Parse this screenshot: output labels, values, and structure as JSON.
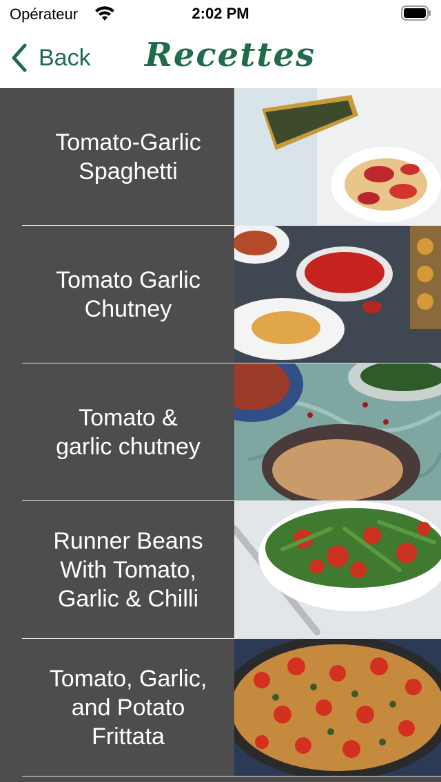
{
  "status_bar": {
    "carrier": "Opérateur",
    "time": "2:02 PM",
    "wifi_icon": "wifi-icon",
    "battery_icon": "battery-icon"
  },
  "nav": {
    "back_label": "Back",
    "back_icon": "chevron-left-icon",
    "title": "Recettes",
    "tint_color": "#1f6b4c"
  },
  "recipes": [
    {
      "title": "Tomato-Garlic\nSpaghetti",
      "image": "frittata-and-spaghetti-photo"
    },
    {
      "title": "Tomato Garlic\nChutney",
      "image": "tomato-sauce-bowl-photo"
    },
    {
      "title": "Tomato &\ngarlic chutney",
      "image": "chutney-bowls-photo"
    },
    {
      "title": "Runner Beans\nWith Tomato,\nGarlic & Chilli",
      "image": "green-beans-tomato-photo"
    },
    {
      "title": "Tomato, Garlic,\nand Potato\nFrittata",
      "image": "potato-frittata-photo"
    }
  ],
  "colors": {
    "list_background": "#4d4d4d",
    "row_text": "#ffffff",
    "separator": "#e6e6e6"
  }
}
